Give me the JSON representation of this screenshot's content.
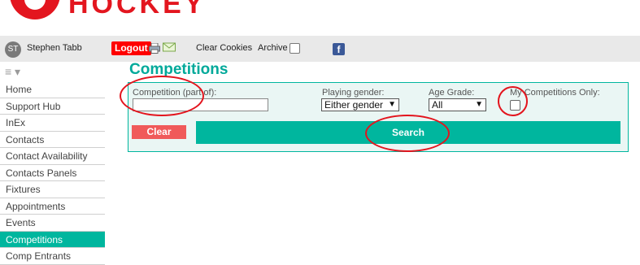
{
  "logo": {
    "text": "HOCKEY"
  },
  "toolbar": {
    "avatar_initials": "ST",
    "user_name": "Stephen Tabb",
    "logout_label": "Logout",
    "clear_cookies_label": "Clear Cookies",
    "archive_label": "Archive",
    "archive_checked": false,
    "facebook_glyph": "f"
  },
  "sidebar": {
    "menu_glyph": "≡ ▾",
    "items": [
      {
        "label": "Home"
      },
      {
        "label": "Support Hub"
      },
      {
        "label": "InEx"
      },
      {
        "label": "Contacts"
      },
      {
        "label": "Contact Availability"
      },
      {
        "label": "Contacts Panels"
      },
      {
        "label": "Fixtures"
      },
      {
        "label": "Appointments"
      },
      {
        "label": "Events"
      },
      {
        "label": "Competitions"
      },
      {
        "label": "Comp Entrants"
      }
    ],
    "active_index": 9
  },
  "main": {
    "title": "Competitions",
    "filters": {
      "competition_label": "Competition (part of):",
      "competition_value": "",
      "gender_label": "Playing gender:",
      "gender_value": "Either gender",
      "age_label": "Age Grade:",
      "age_value": "All",
      "my_comps_label": "My Competitions Only:",
      "my_comps_checked": false
    },
    "clear_label": "Clear",
    "search_label": "Search"
  },
  "colors": {
    "accent": "#00b69e",
    "title": "#00a99a",
    "logout": "#ff0000",
    "clear": "#f05a5a",
    "annotation": "#e3141d"
  },
  "icons": [
    "printer-icon",
    "email-icon",
    "facebook-icon",
    "menu-icon",
    "chevron-down-icon"
  ]
}
